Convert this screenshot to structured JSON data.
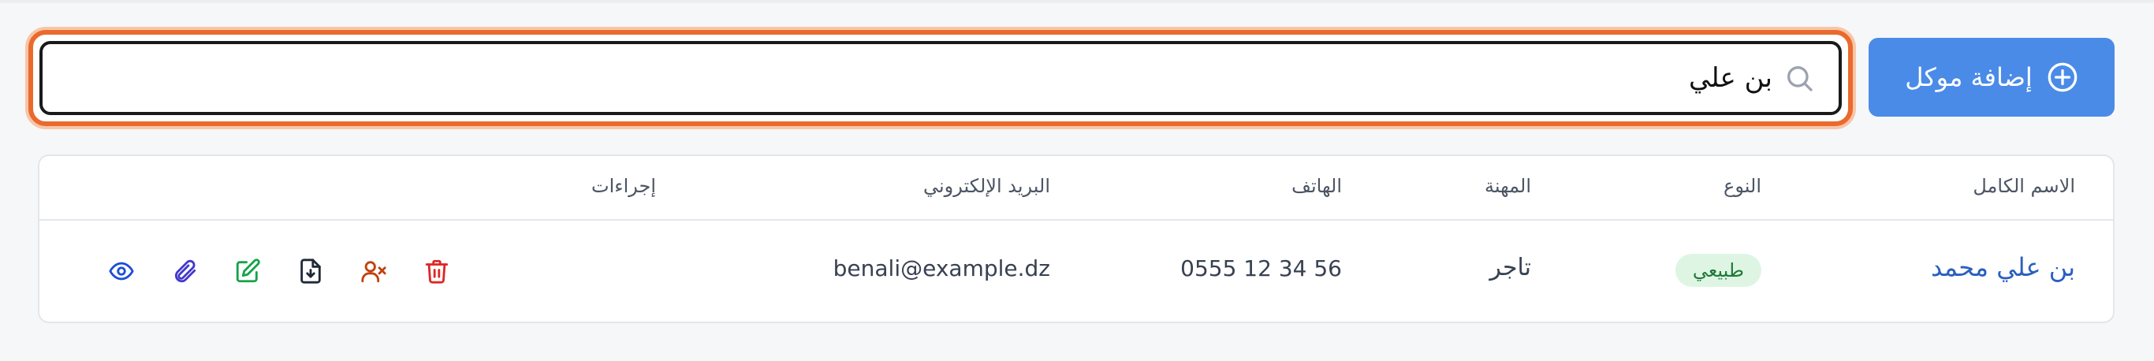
{
  "toolbar": {
    "add_client_label": "إضافة موكل"
  },
  "search": {
    "value": "بن علي",
    "placeholder": ""
  },
  "table": {
    "headers": {
      "full_name": "الاسم الكامل",
      "type": "النوع",
      "profession": "المهنة",
      "phone": "الهاتف",
      "email": "البريد الإلكتروني",
      "actions": "إجراءات"
    },
    "rows": [
      {
        "full_name": "بن علي محمد",
        "type": "طبيعي",
        "profession": "تاجر",
        "phone": "0555 12 34 56",
        "email": "benali@example.dz"
      }
    ]
  },
  "colors": {
    "primary": "#4a8be8",
    "search_focus": "#ea6a2e",
    "badge_bg": "#dff5e4",
    "badge_text": "#1d7a36",
    "delete": "#dc2626",
    "deactivate": "#c2410c",
    "edit": "#16a34a",
    "view": "#1d4ed8",
    "attach": "#4338ca"
  },
  "icons": {
    "add": "plus-circle-icon",
    "search": "search-icon",
    "row_actions": [
      "view-icon",
      "attachment-icon",
      "edit-icon",
      "download-document-icon",
      "remove-user-icon",
      "trash-icon"
    ]
  }
}
